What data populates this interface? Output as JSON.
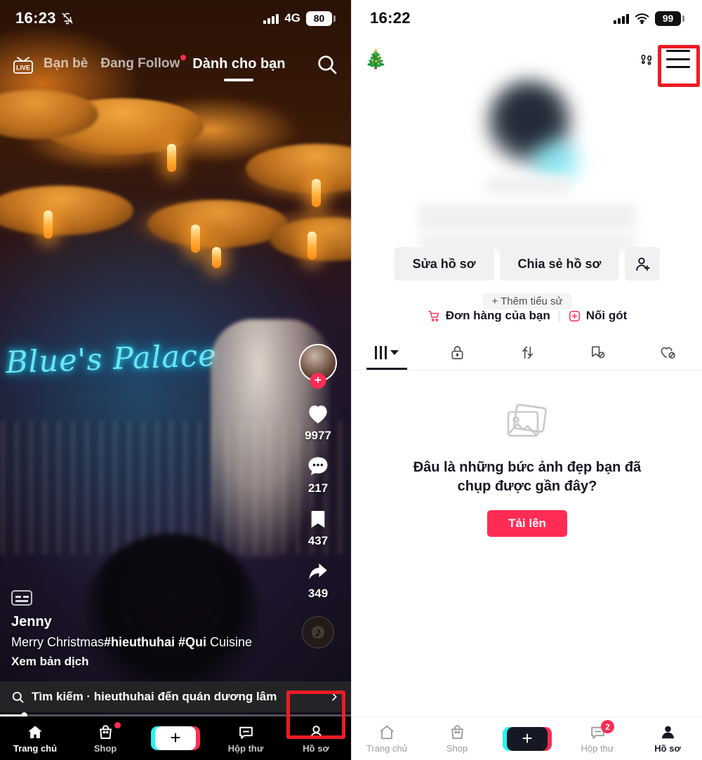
{
  "left_phone": {
    "status_bar": {
      "time": "16:23",
      "mute_icon": "bell-off-icon",
      "signal_icon": "signal-bars-icon",
      "network": "4G",
      "battery": "80"
    },
    "feed_tabs": {
      "live_label": "LIVE",
      "items": [
        {
          "label": "Bạn bè",
          "active": false,
          "badge": false
        },
        {
          "label": "Đang Follow",
          "active": false,
          "badge": true
        },
        {
          "label": "Dành cho bạn",
          "active": true,
          "badge": false
        }
      ],
      "search_icon": "search-icon"
    },
    "video": {
      "neon_sign": "Blue's Palace"
    },
    "action_rail": {
      "follow_plus": "+",
      "like_count": "9977",
      "comment_count": "217",
      "bookmark_count": "437",
      "share_count": "349",
      "music_disc": "♪"
    },
    "caption": {
      "cc_icon": "closed-caption-icon",
      "username": "Jenny",
      "text_plain_1": "Merry Christmas",
      "text_bold": "#hieuthuhai #Qui",
      "text_plain_2": " Cuisine",
      "translate": "Xem bản dịch"
    },
    "search_strip": {
      "icon": "search-icon",
      "text": "Tìm kiếm · hieuthuhai đến quán dương lâm",
      "chevron": "chevron-right-icon"
    },
    "tabbar": [
      {
        "label": "Trang chủ",
        "icon": "home-icon",
        "active": true,
        "badge": ""
      },
      {
        "label": "Shop",
        "icon": "shop-bag-icon",
        "active": false,
        "badge": "dot"
      },
      {
        "label": "",
        "icon": "create-plus-icon",
        "active": false,
        "badge": ""
      },
      {
        "label": "Hộp thư",
        "icon": "inbox-icon",
        "active": false,
        "badge": ""
      },
      {
        "label": "Hồ sơ",
        "icon": "profile-person-icon",
        "active": false,
        "badge": ""
      }
    ],
    "highlight_color": "#ed1c24"
  },
  "right_phone": {
    "status_bar": {
      "time": "16:22",
      "signal_icon": "signal-bars-icon",
      "wifi_icon": "wifi-icon",
      "battery": "99"
    },
    "header": {
      "tree_icon": "christmas-tree-icon",
      "footprints_icon": "footprints-icon",
      "menu_icon": "hamburger-menu-icon"
    },
    "actions": {
      "edit_profile": "Sửa hồ sơ",
      "share_profile": "Chia sẻ hồ sơ",
      "add_friend_icon": "add-person-icon"
    },
    "add_bio": "+ Thêm tiểu sử",
    "meta": {
      "orders_icon": "shopping-cart-icon",
      "orders": "Đơn hàng của bạn",
      "follow_icon": "add-box-icon",
      "follow": "Nối gót"
    },
    "content_tabs": [
      {
        "icon": "grid-posts-icon",
        "active": true
      },
      {
        "icon": "lock-private-icon",
        "active": false
      },
      {
        "icon": "repost-icon",
        "active": false
      },
      {
        "icon": "bookmark-hidden-icon",
        "active": false
      },
      {
        "icon": "heart-hidden-icon",
        "active": false
      }
    ],
    "empty_state": {
      "image_icon": "photo-stack-icon",
      "title": "Đâu là những bức ảnh đẹp bạn đã chụp được gần đây?",
      "button": "Tải lên"
    },
    "tabbar": [
      {
        "label": "Trang chủ",
        "icon": "home-icon",
        "active": false,
        "badge": ""
      },
      {
        "label": "Shop",
        "icon": "shop-bag-icon",
        "active": false,
        "badge": ""
      },
      {
        "label": "",
        "icon": "create-plus-icon",
        "active": false,
        "badge": ""
      },
      {
        "label": "Hộp thư",
        "icon": "inbox-icon",
        "active": false,
        "badge": "2"
      },
      {
        "label": "Hồ sơ",
        "icon": "profile-person-icon",
        "active": true,
        "badge": ""
      }
    ],
    "highlight_color": "#ed1c24"
  },
  "colors": {
    "accent_pink": "#fe2c55",
    "accent_cyan": "#25f4ee",
    "highlight_red": "#ed1c24",
    "text_dark": "#161823"
  }
}
